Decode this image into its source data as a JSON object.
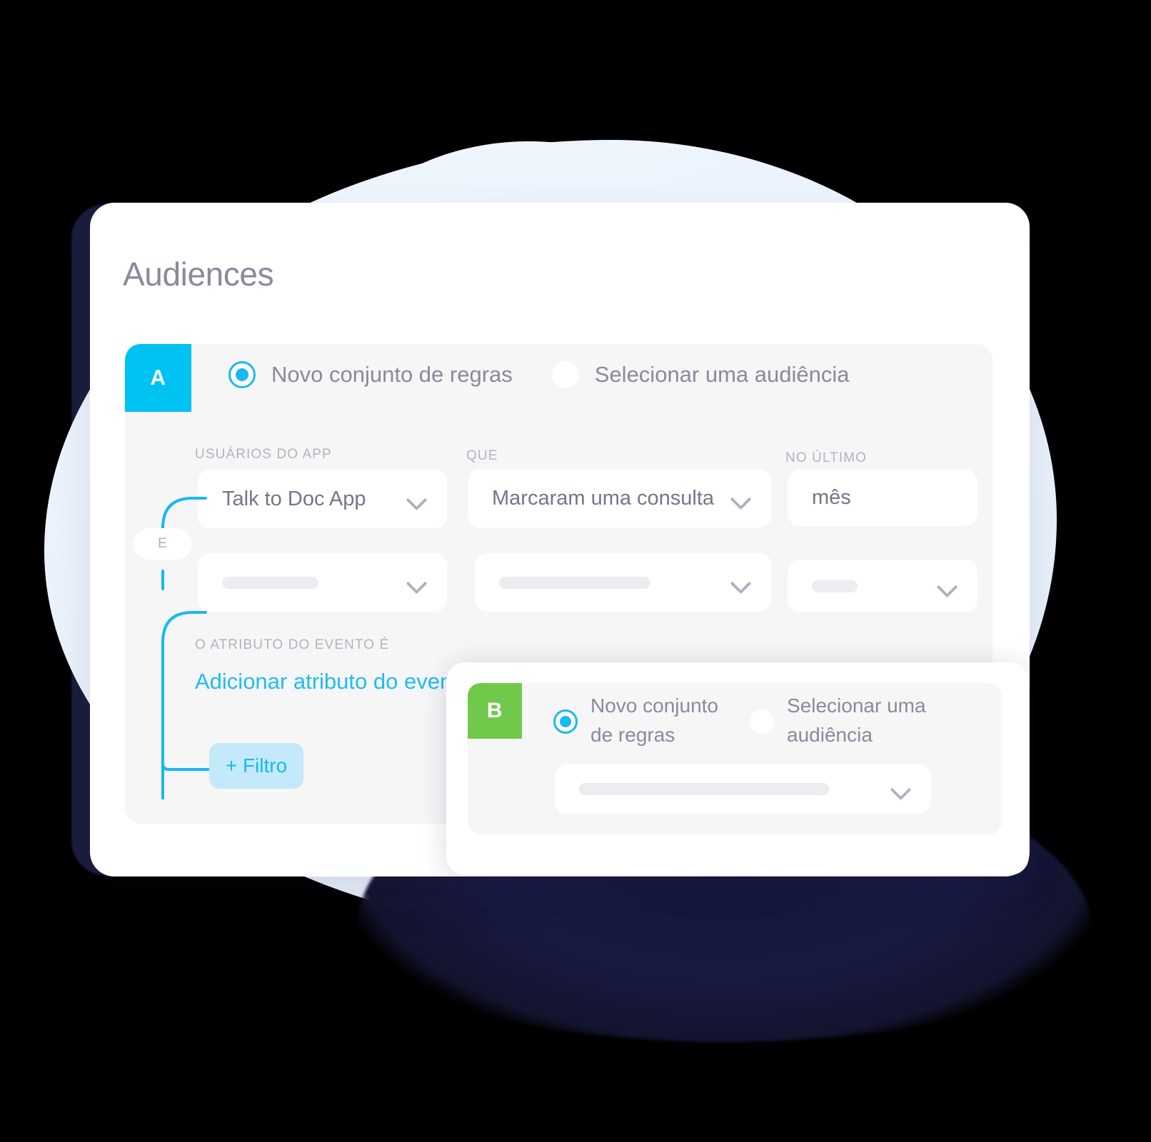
{
  "page": {
    "title": "Audiences"
  },
  "colors": {
    "badge_a": "#00c2f3",
    "badge_b": "#71c94c",
    "accent_cyan": "#18b9f0",
    "link_cyan": "#1ebcf5",
    "filter_button_bg": "#c3e9fa",
    "panel_bg": "#f6f6f7",
    "card_bg": "#ffffff",
    "text_muted": "#8b8a9c",
    "label_muted": "#b3b2c1",
    "backdrop_blob": "#eaf2fc"
  },
  "group_a": {
    "badge": "A",
    "radios": [
      {
        "label": "Novo conjunto de regras",
        "selected": true
      },
      {
        "label": "Selecionar uma audiência",
        "selected": false
      }
    ],
    "connector_label": "E",
    "columns": [
      {
        "label": "USUÁRIOS DO APP",
        "rows": [
          {
            "value": "Talk to Doc App",
            "placeholder": "",
            "has_chevron": true
          },
          {
            "value": "",
            "placeholder": "",
            "has_chevron": true
          }
        ]
      },
      {
        "label": "QUE",
        "rows": [
          {
            "value": "Marcaram uma consulta",
            "placeholder": "",
            "has_chevron": true
          },
          {
            "value": "",
            "placeholder": "",
            "has_chevron": true
          }
        ]
      },
      {
        "label": "NO ÚLTIMO",
        "rows": [
          {
            "value": "mês",
            "placeholder": "",
            "has_chevron": false
          },
          {
            "value": "",
            "placeholder": "",
            "has_chevron": true
          }
        ]
      }
    ],
    "attribute_label": "O ATRIBUTO DO EVENTO É",
    "attribute_link": "Adicionar atributo do evento",
    "filter_button": "+ Filtro"
  },
  "group_b": {
    "badge": "B",
    "radios": [
      {
        "label": "Novo conjunto\nde regras",
        "selected": true
      },
      {
        "label": "Selecionar uma\naudiência",
        "selected": false
      }
    ],
    "select": {
      "value": "",
      "placeholder": "",
      "has_chevron": true
    }
  }
}
